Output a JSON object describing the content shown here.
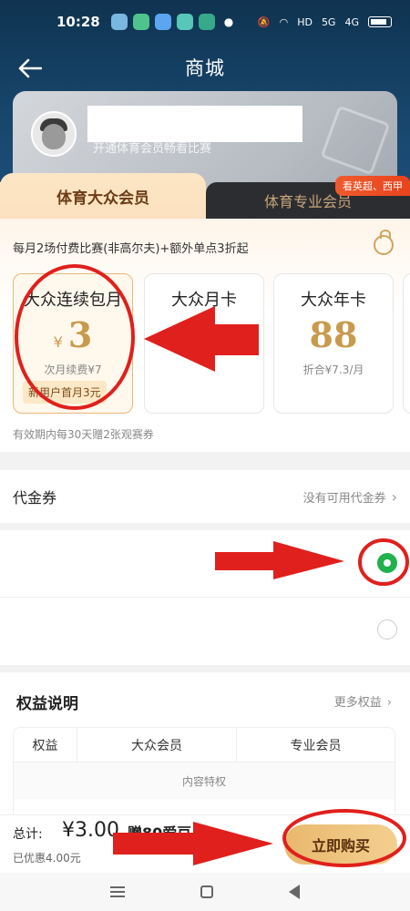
{
  "status_bar": {
    "time": "10:28",
    "network_labels": [
      "HD",
      "5G",
      "4G"
    ]
  },
  "header": {
    "title": "商城"
  },
  "user_card": {
    "subtitle": "开通体育会员畅看比赛"
  },
  "tabs": [
    {
      "label": "体育大众会员",
      "active": true
    },
    {
      "label": "体育专业会员",
      "active": false,
      "badge": "看英超、西甲"
    }
  ],
  "plans": {
    "promo": "每月2场付费比赛(非高尔夫)+额外单点3折起",
    "items": [
      {
        "name": "大众连续包月",
        "currency": "¥",
        "price": "3",
        "sub": "次月续费¥7",
        "tag": "新用户首月3元",
        "selected": true
      },
      {
        "name": "大众月卡",
        "currency": "",
        "price": "",
        "sub": "",
        "tag": "",
        "selected": false
      },
      {
        "name": "大众年卡",
        "currency": "",
        "price": "88",
        "sub": "折合¥7.3/月",
        "tag": "",
        "selected": false
      }
    ],
    "note": "有效期内每30天赠2张观赛券"
  },
  "voucher": {
    "label": "代金券",
    "value": "没有可用代金券"
  },
  "payment_options": [
    {
      "selected": true
    },
    {
      "selected": false
    }
  ],
  "benefits": {
    "title": "权益说明",
    "more": "更多权益",
    "columns": [
      "权益",
      "大众会员",
      "专业会员"
    ],
    "section": "内容特权"
  },
  "purchase": {
    "total_label": "总计:",
    "total_amount": "¥3.00",
    "gift": "赠80爱豆",
    "saved": "已优惠4.00元",
    "button": "立即购买"
  },
  "colors": {
    "accent_gold": "#c99a4d",
    "header_bg": "#17456b",
    "radio_on": "#22b14c",
    "annotation_red": "#e0201c"
  }
}
